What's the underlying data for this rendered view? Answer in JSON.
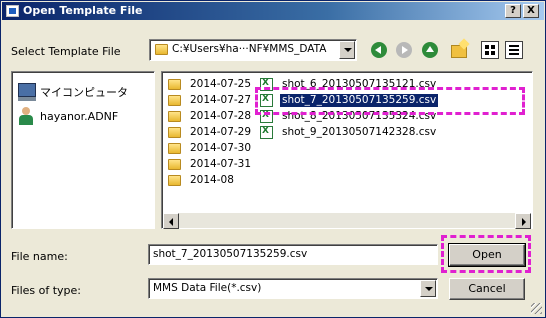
{
  "window": {
    "title": "Open Template File",
    "help_label": "?",
    "close_label": "X"
  },
  "toolbar": {
    "select_label": "Select Template File",
    "path_value": "C:¥Users¥ha···NF¥MMS_DATA",
    "icons": [
      "back-icon",
      "forward-icon",
      "up-folder-icon",
      "new-folder-icon",
      "view-menu-icon",
      "details-view-icon"
    ]
  },
  "places": [
    {
      "label": "マイコンピュータ",
      "icon": "computer-icon"
    },
    {
      "label": "hayanor.ADNF",
      "icon": "user-icon"
    }
  ],
  "folders": [
    {
      "label": "2014-07-25"
    },
    {
      "label": "2014-07-27"
    },
    {
      "label": "2014-07-28"
    },
    {
      "label": "2014-07-29"
    },
    {
      "label": "2014-07-30"
    },
    {
      "label": "2014-07-31"
    },
    {
      "label": "2014-08"
    }
  ],
  "files": [
    {
      "label": "shot_6_20130507135121.csv",
      "selected": false
    },
    {
      "label": "shot_7_20130507135259.csv",
      "selected": true
    },
    {
      "label": "shot_8_20130507135324.csv",
      "selected": false
    },
    {
      "label": "shot_9_20130507142328.csv",
      "selected": false
    }
  ],
  "form": {
    "filename_label": "File name:",
    "filename_value": "shot_7_20130507135259.csv",
    "filetype_label": "Files of type:",
    "filetype_value": "MMS Data File(*.csv)",
    "open_label": "Open",
    "cancel_label": "Cancel"
  },
  "colors": {
    "titlebar": "#0a246a",
    "selection": "#0a246a",
    "annotation": "#e020d0",
    "dialog_bg": "#ece9d8"
  }
}
